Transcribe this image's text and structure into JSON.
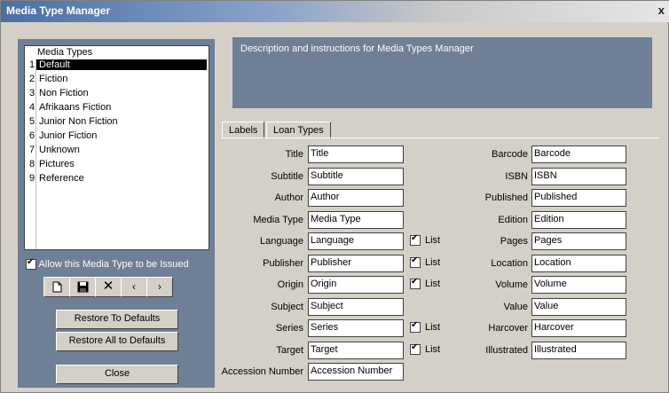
{
  "window": {
    "title": "Media Type Manager",
    "close_label": "x"
  },
  "media_list": {
    "header": "Media Types",
    "items": [
      {
        "num": "1",
        "label": "Default",
        "selected": true
      },
      {
        "num": "2",
        "label": "Fiction"
      },
      {
        "num": "3",
        "label": "Non Fiction"
      },
      {
        "num": "4",
        "label": "Afrikaans Fiction"
      },
      {
        "num": "5",
        "label": "Junior Non Fiction"
      },
      {
        "num": "6",
        "label": "Junior Fiction"
      },
      {
        "num": "7",
        "label": "Unknown"
      },
      {
        "num": "8",
        "label": "Pictures"
      },
      {
        "num": "9",
        "label": "Reference"
      }
    ]
  },
  "issue_checkbox": {
    "label": "Allow this Media Type to be Issued",
    "checked": true
  },
  "toolbar": {
    "new_icon": "document-icon",
    "save_icon": "floppy-disk-icon",
    "delete_icon": "x-delete-icon",
    "prev": "‹",
    "next": "›"
  },
  "buttons": {
    "restore_defaults": "Restore To Defaults",
    "restore_all": "Restore All to Defaults",
    "close": "Close"
  },
  "description": "Description and instructions for Media Types Manager",
  "tabs": {
    "labels": "Labels",
    "loan_types": "Loan Types"
  },
  "list_label": "List",
  "left_fields": [
    {
      "label": "Title",
      "value": "Title"
    },
    {
      "label": "Subtitle",
      "value": "Subtitle"
    },
    {
      "label": "Author",
      "value": "Author"
    },
    {
      "label": "Media Type",
      "value": "Media Type"
    },
    {
      "label": "Language",
      "value": "Language",
      "list": true
    },
    {
      "label": "Publisher",
      "value": "Publisher",
      "list": true
    },
    {
      "label": "Origin",
      "value": "Origin",
      "list": true
    },
    {
      "label": "Subject",
      "value": "Subject"
    },
    {
      "label": "Series",
      "value": "Series",
      "list": true
    },
    {
      "label": "Target",
      "value": "Target",
      "list": true
    },
    {
      "label": "Accession Number",
      "value": "Accession Number"
    }
  ],
  "right_fields": [
    {
      "label": "Barcode",
      "value": "Barcode"
    },
    {
      "label": "ISBN",
      "value": "ISBN"
    },
    {
      "label": "Published",
      "value": "Published"
    },
    {
      "label": "Edition",
      "value": "Edition"
    },
    {
      "label": "Pages",
      "value": "Pages"
    },
    {
      "label": "Location",
      "value": "Location"
    },
    {
      "label": "Volume",
      "value": "Volume"
    },
    {
      "label": "Value",
      "value": "Value"
    },
    {
      "label": "Harcover",
      "value": "Harcover"
    },
    {
      "label": "Illustrated",
      "value": "Illustrated"
    }
  ]
}
